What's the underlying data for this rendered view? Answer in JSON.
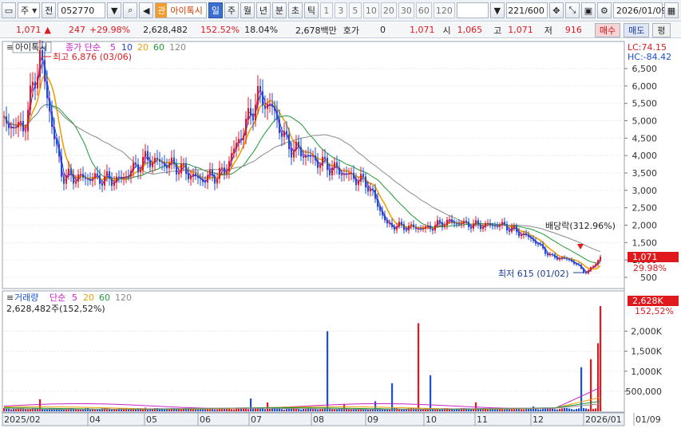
{
  "toolbar": {
    "type_label": "주",
    "prefix_label": "전",
    "code": "052770",
    "stock_tag": "관",
    "stock_name": "아이톡시",
    "periods": [
      "일",
      "주",
      "월",
      "년",
      "분",
      "초",
      "틱"
    ],
    "active_period": "일",
    "intervals": [
      "1",
      "3",
      "5",
      "10",
      "20",
      "30",
      "60",
      "120"
    ],
    "count": "221",
    "total": "/600",
    "date": "2026/01/09"
  },
  "infobar": {
    "price": "1,071",
    "change": "247",
    "change_pct": "+29.98%",
    "volume": "2,628,482",
    "vol_ratio": "152.52%",
    "turnover": "18.04%",
    "amount": "2,678백만",
    "quote_label": "호가",
    "quote_value": "0",
    "quote_price": "1,071",
    "open_label": "시",
    "open": "1,065",
    "high_label": "고",
    "high": "1,071",
    "low_label": "저",
    "low": "916",
    "buy_label": "매수",
    "sell_label": "매도",
    "eval_label": "평"
  },
  "price_panel": {
    "stock_label": "아이톡시",
    "ma_label": "종가 단순",
    "ma_periods": [
      "5",
      "10",
      "20",
      "60",
      "120"
    ],
    "ma_colors": [
      "#cc22cc",
      "#1a3fd0",
      "#f0a000",
      "#1e9a33",
      "#8a8a8a"
    ],
    "lc_label": "LC:74.15",
    "hc_label": "HC:-84.42",
    "high_annot": "최고 6,876 (03/06)",
    "low_annot": "최저 615 (01/02)",
    "dividend_annot": "배당락(312.96%)",
    "current_price": "1,071",
    "current_pct": "29.98%",
    "y_ticks": [
      "6,500",
      "6,000",
      "5,500",
      "5,000",
      "4,500",
      "4,000",
      "3,500",
      "3,000",
      "2,500",
      "2,000",
      "1,500",
      "1,000",
      "500"
    ]
  },
  "volume_panel": {
    "label": "거래량",
    "ma_label": "단순",
    "ma_periods": [
      "5",
      "20",
      "60",
      "120"
    ],
    "ma_colors": [
      "#cc22cc",
      "#f0a000",
      "#1e9a33",
      "#8a8a8a"
    ],
    "volume_text": "2,628,482주(152,52%)",
    "current_vol": "2,628K",
    "current_pct": "152,52%",
    "y_ticks": [
      "2,000K",
      "1,500K",
      "1,000K",
      "500,000"
    ]
  },
  "x_axis": [
    "2025/02",
    "04",
    "05",
    "06",
    "07",
    "08",
    "09",
    "10",
    "11",
    "12",
    "2026/01",
    "01/09"
  ],
  "colors": {
    "up": "#e0191f",
    "down": "#1b4fd6",
    "accent": "#3a6fd0"
  },
  "chart_data": {
    "type": "candlestick",
    "series": [
      {
        "name": "종가 단순 5",
        "values": []
      },
      {
        "name": "10",
        "values": []
      },
      {
        "name": "20",
        "values": []
      },
      {
        "name": "60",
        "values": []
      },
      {
        "name": "120",
        "values": []
      }
    ],
    "close_path": [
      [
        "2025/02",
        4900
      ],
      [
        "02/15",
        4800
      ],
      [
        "03/06",
        6876
      ],
      [
        "03/10",
        5600
      ],
      [
        "03/15",
        4500
      ],
      [
        "03/20",
        3400
      ],
      [
        "04",
        3350
      ],
      [
        "04/15",
        3300
      ],
      [
        "05",
        3900
      ],
      [
        "05/15",
        3700
      ],
      [
        "06",
        3300
      ],
      [
        "06/15",
        3500
      ],
      [
        "07",
        5200
      ],
      [
        "07/10",
        5700
      ],
      [
        "07/20",
        5400
      ],
      [
        "07/25",
        4300
      ],
      [
        "08",
        3900
      ],
      [
        "08/15",
        3600
      ],
      [
        "09",
        3200
      ],
      [
        "09/10",
        2500
      ],
      [
        "09/15",
        2000
      ],
      [
        "10",
        1900
      ],
      [
        "10/15",
        2100
      ],
      [
        "11",
        2000
      ],
      [
        "11/20",
        2000
      ],
      [
        "12",
        1600
      ],
      [
        "12/10",
        1100
      ],
      [
        "12/20",
        1000
      ],
      [
        "2026/01/02",
        615
      ],
      [
        "01/09",
        1071
      ]
    ],
    "volume_bars_k": [
      [
        "2025/02",
        80
      ],
      [
        "03/06",
        300
      ],
      [
        "04",
        60
      ],
      [
        "05",
        90
      ],
      [
        "06",
        70
      ],
      [
        "07",
        320
      ],
      [
        "07/12",
        220
      ],
      [
        "08/05",
        2000
      ],
      [
        "08/20",
        180
      ],
      [
        "09/05",
        250
      ],
      [
        "09/20",
        700
      ],
      [
        "10/01",
        2200
      ],
      [
        "10/05",
        900
      ],
      [
        "11",
        220
      ],
      [
        "12",
        120
      ],
      [
        "12/25",
        1100
      ],
      [
        "2026/01/05",
        1300
      ],
      [
        "01/07",
        1700
      ],
      [
        "01/09",
        2628
      ]
    ],
    "ylim_price": [
      500,
      6876
    ],
    "ylim_volume": [
      0,
      2628
    ]
  }
}
